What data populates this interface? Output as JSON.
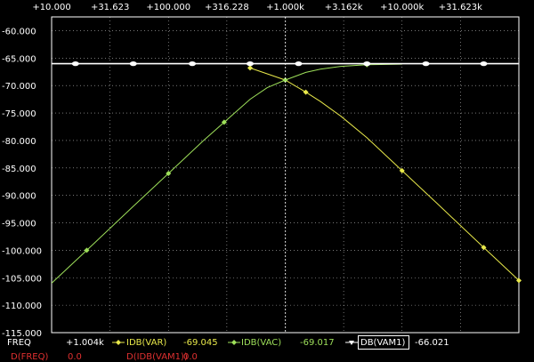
{
  "colors": {
    "background": "#000000",
    "grid": "#ffffff",
    "var_trace": "#e8e84a",
    "vac_trace": "#9ee05a",
    "vam1_trace": "#ffffff",
    "cursor_row2": "#e03030"
  },
  "readout": {
    "freq_label": "FREQ",
    "freq_value": "+1.004k",
    "var_label": "IDB(VAR)",
    "var_value": "-69.045",
    "vac_label": "IDB(VAC)",
    "vac_value": "-69.017",
    "vam1_label": "DB(VAM1)",
    "vam1_value": "-66.021",
    "row2_label": "D(FREQ)",
    "row2_value": "0.0",
    "row2b_label": "D(IDB(VAM1))",
    "row2b_value": "0.0"
  },
  "chart_data": {
    "type": "line",
    "x_scale": "log",
    "xlim": [
      10,
      100000
    ],
    "ylim": [
      -115,
      -57.5
    ],
    "grid": true,
    "x_tick_values": [
      10,
      31.623,
      100,
      316.228,
      1000,
      3162,
      10000,
      31623
    ],
    "x_tick_labels": [
      "+10.000",
      "+31.623",
      "+100.000",
      "+316.228",
      "+1.000k",
      "+3.162k",
      "+10.000k",
      "+31.623k"
    ],
    "y_tick_values": [
      -60,
      -65,
      -70,
      -75,
      -80,
      -85,
      -90,
      -95,
      -100,
      -105,
      -110,
      -115
    ],
    "y_tick_labels": [
      "-60.000",
      "-65.000",
      "-70.000",
      "-75.000",
      "-80.000",
      "-85.000",
      "-90.000",
      "-95.000",
      "-100.000",
      "-105.000",
      "-110.000",
      "-115.000"
    ],
    "series": [
      {
        "name": "IDB(VAR)",
        "color": "#e8e84a",
        "marker": "diamond",
        "x": [
          500,
          1000,
          1500,
          2000,
          3000,
          5000,
          10000,
          20000,
          50000,
          100000
        ],
        "y": [
          -66.8,
          -69.0,
          -71.2,
          -72.9,
          -75.6,
          -79.5,
          -85.5,
          -91.5,
          -99.5,
          -105.5
        ],
        "marker_x": [
          500,
          1500,
          10000,
          50000,
          100000
        ]
      },
      {
        "name": "IDB(VAC)",
        "color": "#9ee05a",
        "marker": "diamond",
        "x": [
          10,
          20,
          50,
          100,
          200,
          500,
          700,
          1000,
          1500,
          2000,
          3000,
          5000,
          10000
        ],
        "y": [
          -106.0,
          -100.0,
          -92.0,
          -86.0,
          -80.0,
          -72.5,
          -70.4,
          -69.0,
          -67.6,
          -67.0,
          -66.5,
          -66.2,
          -66.1
        ],
        "marker_x": [
          20,
          100,
          300,
          1000,
          5000
        ]
      },
      {
        "name": "DB(VAM1)",
        "color": "#ffffff",
        "marker": "circle",
        "x": [
          10,
          100000
        ],
        "y": [
          -66.021,
          -66.021
        ],
        "marker_x": [
          16,
          50,
          160,
          500,
          1300,
          5000,
          16000,
          50000
        ]
      }
    ]
  }
}
